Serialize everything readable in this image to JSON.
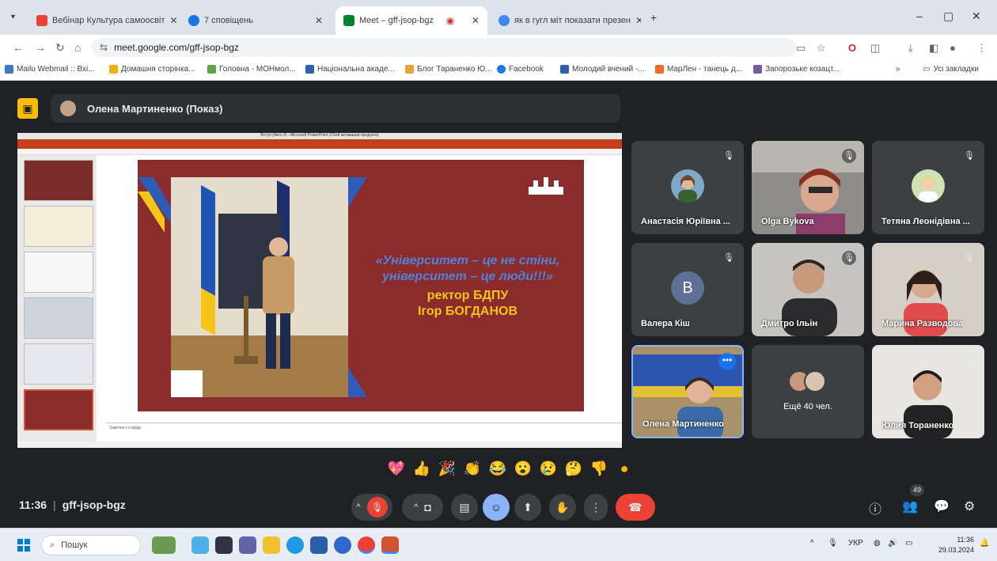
{
  "browser": {
    "tabs": [
      {
        "label": "Вебінар Культура самоосвіт"
      },
      {
        "label": "7 сповіщень"
      },
      {
        "label": "Meet – gff-jsop-bgz"
      },
      {
        "label": "як в гугл міт показати презен"
      }
    ],
    "url": "meet.google.com/gff-jsop-bgz",
    "bookmarks": [
      "Mailu Webmail :: Вхі...",
      "Домашня сторінка...",
      "Головна - МОНмол...",
      "Національна акаде...",
      "Блог Тараненко Ю...",
      "Facebook",
      "Молодий вчений -...",
      "MapЛен - танець д...",
      "Запорозьке козацт..."
    ],
    "bookmarks_more": "»",
    "all_bookmarks": "Усі закладки"
  },
  "meet": {
    "presenter_label": "Олена Мартиненко (Показ)",
    "slide": {
      "pp_title": "Вступ (Авто 2) - Microsoft PowerPoint (Сбой активации продукта)",
      "quote": "«Університет – це не стіни, університет – це люди!!!»",
      "author_title": "ректор БДПУ",
      "author_name": "Ігор БОГДАНОВ",
      "notes_placeholder": "Заметки к слайду"
    },
    "participants": [
      {
        "name": "Анастасія Юріївна ...",
        "kind": "avatar"
      },
      {
        "name": "Olga Bykova",
        "kind": "video"
      },
      {
        "name": "Тетяна Леонідівна ...",
        "kind": "avatar"
      },
      {
        "name": "Валера Кіш",
        "kind": "letter",
        "letter": "B",
        "avatar_color": "#5f6f96"
      },
      {
        "name": "Дмитро Ільін",
        "kind": "video"
      },
      {
        "name": "Марина Разводова",
        "kind": "video"
      },
      {
        "name": "Олена Мартиненко",
        "kind": "video",
        "speaking": true
      },
      {
        "name": "Ещё 40 чел.",
        "kind": "more"
      },
      {
        "name": "Юлия Тораненко",
        "kind": "video"
      }
    ],
    "reactions": [
      "💖",
      "👍",
      "🎉",
      "👏",
      "😂",
      "😮",
      "😢",
      "🤔",
      "👎",
      "●"
    ],
    "time": "11:36",
    "meeting_code": "gff-jsop-bgz",
    "participant_count": "49"
  },
  "taskbar": {
    "search_label": "Пошук",
    "lang": "УКР",
    "clock_time": "11:36",
    "clock_date": "29.03.2024"
  },
  "colors": {
    "accent": "#8ab4f8",
    "hangup": "#ea4335",
    "slide_bg": "#8b2b2b",
    "quote_blue": "#4f83d8",
    "quote_yellow": "#f5c518"
  }
}
